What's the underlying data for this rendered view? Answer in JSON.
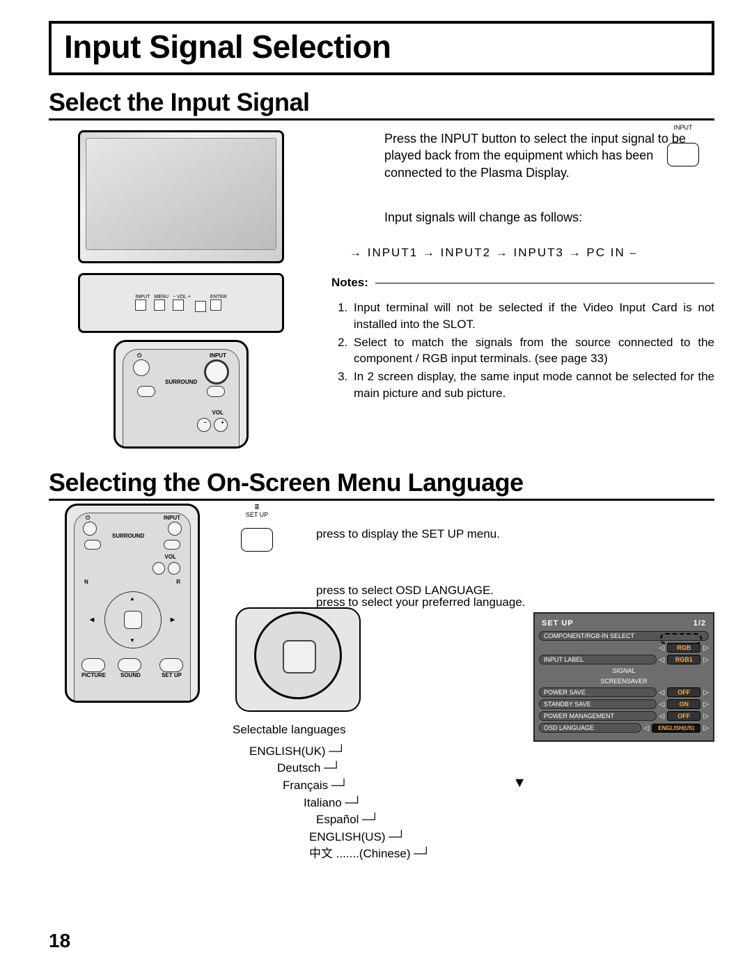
{
  "title": "Input Signal Selection",
  "section1": {
    "heading": "Select the Input Signal",
    "inputButtonLabel": "INPUT",
    "para1": "Press the INPUT button to select the input signal to be played back from the equipment which has been connected to the  Plasma Display.",
    "para2": "Input signals will change as follows:",
    "cycle": "→ INPUT1  → INPUT2  → INPUT3  → PC IN ⎯",
    "notesLegend": "Notes:",
    "notes": [
      "Input terminal will not be selected if the Video Input Card is not installed into the SLOT.",
      "Select to match the signals from the source connected to the component / RGB input terminals. (see page 33)",
      "In 2 screen display, the same input mode cannot be selected for the main picture and sub picture."
    ],
    "panel": {
      "input": "INPUT",
      "menu": "MENU",
      "volMinus": "−  VOL  +",
      "enter": "ENTER"
    },
    "remote": {
      "surround": "SURROUND",
      "input": "INPUT",
      "vol": "VOL",
      "minus": "−",
      "plus": "+"
    }
  },
  "section2": {
    "heading": "Selecting the On-Screen Menu Language",
    "setupLabel": "SET UP",
    "step1": "press to display the SET UP menu.",
    "step2": "press to select OSD LANGUAGE.",
    "step3": "press to select your preferred language.",
    "selLangHeading": "Selectable languages",
    "languages": [
      "ENGLISH(UK)",
      "Deutsch",
      "Français",
      "Italiano",
      "Español",
      "ENGLISH(US)",
      "中文 .......(Chinese)"
    ],
    "remote2": {
      "input": "INPUT",
      "surround": "SURROUND",
      "vol": "VOL",
      "n": "N",
      "r": "R",
      "picture": "PICTURE",
      "sound": "SOUND",
      "setup": "SET UP"
    },
    "osd": {
      "title": "SET UP",
      "page": "1/2",
      "rows": {
        "componentRgb": {
          "label": "COMPONENT/RGB-IN  SELECT",
          "value": "RGB"
        },
        "inputLabel": {
          "label": "INPUT LABEL",
          "value": "RGB1"
        },
        "signal": {
          "label": "SIGNAL"
        },
        "screensaver": {
          "label": "SCREENSAVER"
        },
        "powerSave": {
          "label": "POWER SAVE",
          "value": "OFF"
        },
        "standbySave": {
          "label": "STANDBY SAVE",
          "value": "ON"
        },
        "powerMgmt": {
          "label": "POWER MANAGEMENT",
          "value": "OFF"
        },
        "osdLang": {
          "label": "OSD  LANGUAGE",
          "value": "ENGLISH(US)"
        }
      }
    }
  },
  "pageNumber": "18"
}
